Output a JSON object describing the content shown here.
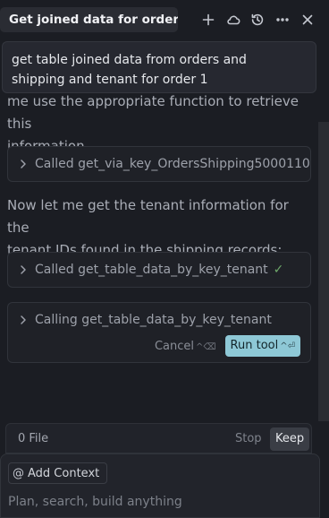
{
  "header": {
    "title": "Get joined data for order 1",
    "icons": [
      "plus-icon",
      "cloud-icon",
      "history-icon",
      "more-icon",
      "close-icon"
    ]
  },
  "conversation": {
    "user_message": {
      "line1": "get table joined data from orders and",
      "line2": "shipping and tenant for order 1"
    },
    "ai_text_1": {
      "line1": "me use the appropriate function to retrieve this",
      "line2": "information."
    },
    "tool_call_1": {
      "label": "Called get_via_key_OrdersShipping5000110",
      "tail": "›"
    },
    "ai_text_2": {
      "line1": "Now let me get the tenant information for the",
      "line2": "tenant IDs found in the shipping records:"
    },
    "tool_call_2": {
      "label": "Called get_table_data_by_key_tenant",
      "status_icon": "✓"
    },
    "tool_call_3": {
      "label": "Calling get_table_data_by_key_tenant",
      "cancel_label": "Cancel",
      "cancel_shortcut": "^⌫",
      "run_label": "Run tool",
      "run_shortcut": "^⏎"
    }
  },
  "footer": {
    "file_count": "0 File",
    "stop_label": "Stop",
    "keep_label": "Keep",
    "add_context_icon": "@",
    "add_context_label": "Add Context",
    "input_placeholder": "Plan, search, build anything"
  },
  "colors": {
    "background": "#1b1d23",
    "accent": "#8ec8d6",
    "success": "#6ea86a"
  }
}
